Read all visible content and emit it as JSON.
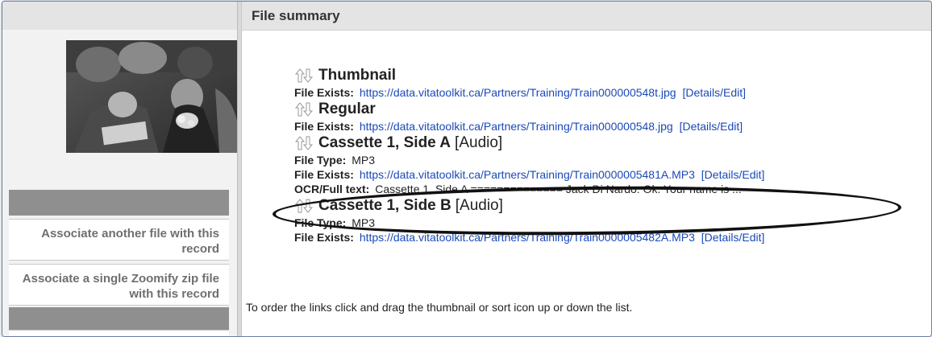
{
  "header": {
    "title": "File summary"
  },
  "sidebar": {
    "links": [
      {
        "label": "Associate another file with this record"
      },
      {
        "label": "Associate a single Zoomify zip file with this record"
      }
    ]
  },
  "files": [
    {
      "name": "Thumbnail",
      "kind": "",
      "rows": [
        {
          "label": "File Exists:",
          "url": "https://data.vitatoolkit.ca/Partners/Training/Train000000548t.jpg",
          "action": "[Details/Edit]"
        }
      ]
    },
    {
      "name": "Regular",
      "kind": "",
      "rows": [
        {
          "label": "File Exists:",
          "url": "https://data.vitatoolkit.ca/Partners/Training/Train000000548.jpg",
          "action": "[Details/Edit]"
        }
      ]
    },
    {
      "name": "Cassette 1, Side A",
      "kind": "[Audio]",
      "rows": [
        {
          "label": "File Type:",
          "value": "MP3"
        },
        {
          "label": "File Exists:",
          "url": "https://data.vitatoolkit.ca/Partners/Training/Train0000005481A.MP3",
          "action": "[Details/Edit]"
        },
        {
          "label": "OCR/Full text:",
          "value": "Cassette 1, Side A ============== Jack Di Nardo: Ok. Your name is ..."
        }
      ]
    },
    {
      "name": "Cassette 1, Side B",
      "kind": "[Audio]",
      "rows": [
        {
          "label": "File Type:",
          "value": "MP3"
        },
        {
          "label": "File Exists:",
          "url": "https://data.vitatoolkit.ca/Partners/Training/Train0000005482A.MP3",
          "action": "[Details/Edit]"
        }
      ]
    }
  ],
  "instructions": "To order the links click and drag the thumbnail or sort icon up or down the list.",
  "icons": {
    "sort": "sort-arrows-icon",
    "photo": "record-thumbnail-photo"
  },
  "colors": {
    "link": "#1a49b8",
    "header_bg": "#e4e4e4",
    "sidebar_bar": "#8f8f8f",
    "sidebar_link_text": "#6f6f6f"
  }
}
